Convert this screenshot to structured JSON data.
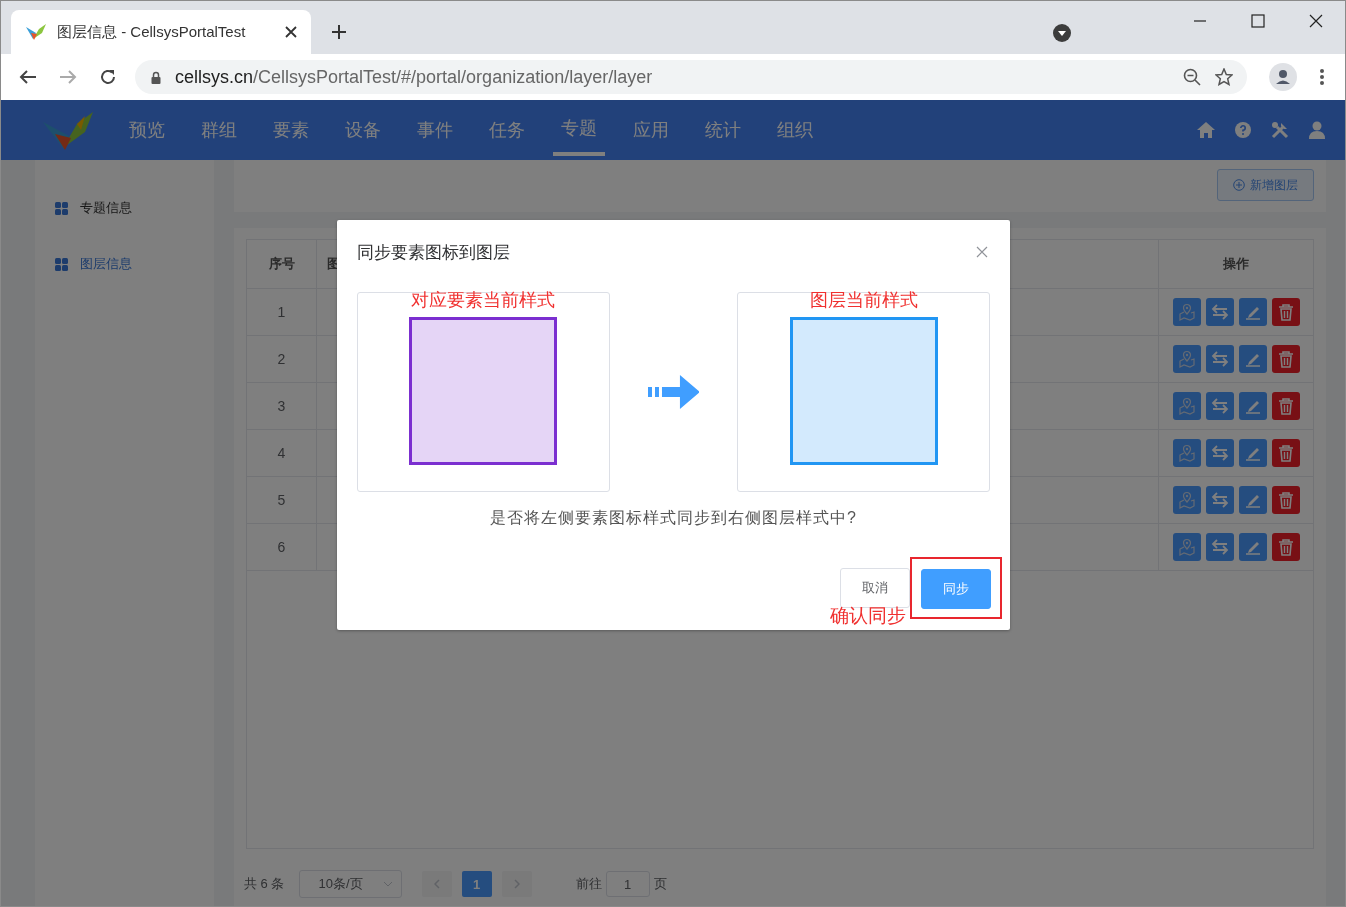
{
  "browser": {
    "tab_title": "图层信息 - CellsysPortalTest",
    "url_host": "cellsys.cn",
    "url_path": "/CellsysPortalTest/#/portal/organization/layer/layer"
  },
  "nav": [
    {
      "label": "预览",
      "selected": false
    },
    {
      "label": "群组",
      "selected": false
    },
    {
      "label": "要素",
      "selected": false
    },
    {
      "label": "设备",
      "selected": false
    },
    {
      "label": "事件",
      "selected": false
    },
    {
      "label": "任务",
      "selected": false
    },
    {
      "label": "专题",
      "selected": true
    },
    {
      "label": "应用",
      "selected": false
    },
    {
      "label": "统计",
      "selected": false
    },
    {
      "label": "组织",
      "selected": false
    }
  ],
  "sidebar": {
    "items": [
      {
        "label": "专题信息",
        "selected": false
      },
      {
        "label": "图层信息",
        "selected": true
      }
    ]
  },
  "toolbar": {
    "add_button": "新增图层"
  },
  "table": {
    "columns": [
      "序号",
      "图",
      "操作"
    ],
    "rows": [
      {
        "index": "1"
      },
      {
        "index": "2"
      },
      {
        "index": "3"
      },
      {
        "index": "4"
      },
      {
        "index": "5"
      },
      {
        "index": "6"
      }
    ],
    "actions": [
      {
        "kind": "map"
      },
      {
        "kind": "swap"
      },
      {
        "kind": "edit"
      },
      {
        "kind": "delete"
      }
    ]
  },
  "pagination": {
    "total": "共 6 条",
    "page_size": "10条/页",
    "pages": [
      {
        "label": "1",
        "selected": true
      }
    ],
    "goto_label": "前往",
    "goto_value": "1",
    "goto_suffix": "页"
  },
  "dialog": {
    "title": "同步要素图标到图层",
    "panels": [
      {
        "label": "对应要素当前样式",
        "color": "#7b2fd0"
      },
      {
        "label": "图层当前样式",
        "color": "#2196f3"
      }
    ],
    "question": "是否将左侧要素图标样式同步到右侧图层样式中?",
    "buttons": [
      {
        "label": "取消",
        "kind": "default"
      },
      {
        "label": "同步",
        "kind": "primary"
      }
    ],
    "annotation": "确认同步"
  }
}
